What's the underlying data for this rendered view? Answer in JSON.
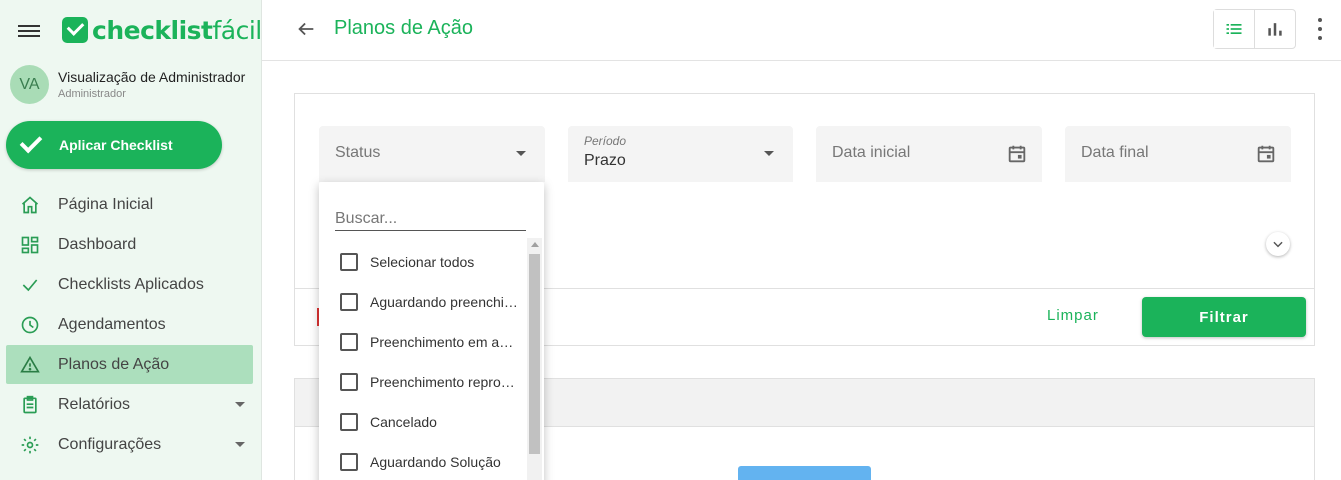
{
  "sidebar": {
    "logo": {
      "bold": "checklist",
      "light": "fácil"
    },
    "user": {
      "initials": "VA",
      "name": "Visualização de Administrador",
      "role": "Administrador"
    },
    "apply_button": "Aplicar Checklist",
    "items": [
      {
        "label": "Página Inicial",
        "icon": "home-icon"
      },
      {
        "label": "Dashboard",
        "icon": "dashboard-icon"
      },
      {
        "label": "Checklists Aplicados",
        "icon": "check-icon"
      },
      {
        "label": "Agendamentos",
        "icon": "clock-icon"
      },
      {
        "label": "Planos de Ação",
        "icon": "warning-icon",
        "active": true
      },
      {
        "label": "Relatórios",
        "icon": "report-icon",
        "expandable": true
      },
      {
        "label": "Configurações",
        "icon": "gear-icon",
        "expandable": true
      }
    ]
  },
  "header": {
    "title": "Planos de Ação"
  },
  "filters": {
    "status": {
      "placeholder": "Status"
    },
    "periodo": {
      "label": "Período",
      "value": "Prazo"
    },
    "data_inicial": {
      "placeholder": "Data inicial"
    },
    "data_final": {
      "placeholder": "Data final"
    },
    "clear_label": "Limpar",
    "filter_label": "Filtrar"
  },
  "dropdown": {
    "search_placeholder": "Buscar...",
    "options": [
      "Selecionar todos",
      "Aguardando preenchimento",
      "Preenchimento em andamento",
      "Preenchimento reprovado",
      "Cancelado",
      "Aguardando Solução"
    ]
  },
  "colors": {
    "brand": "#1bb35a",
    "active_nav": "#acdfbd",
    "sidebar_bg": "#eef8f1"
  }
}
